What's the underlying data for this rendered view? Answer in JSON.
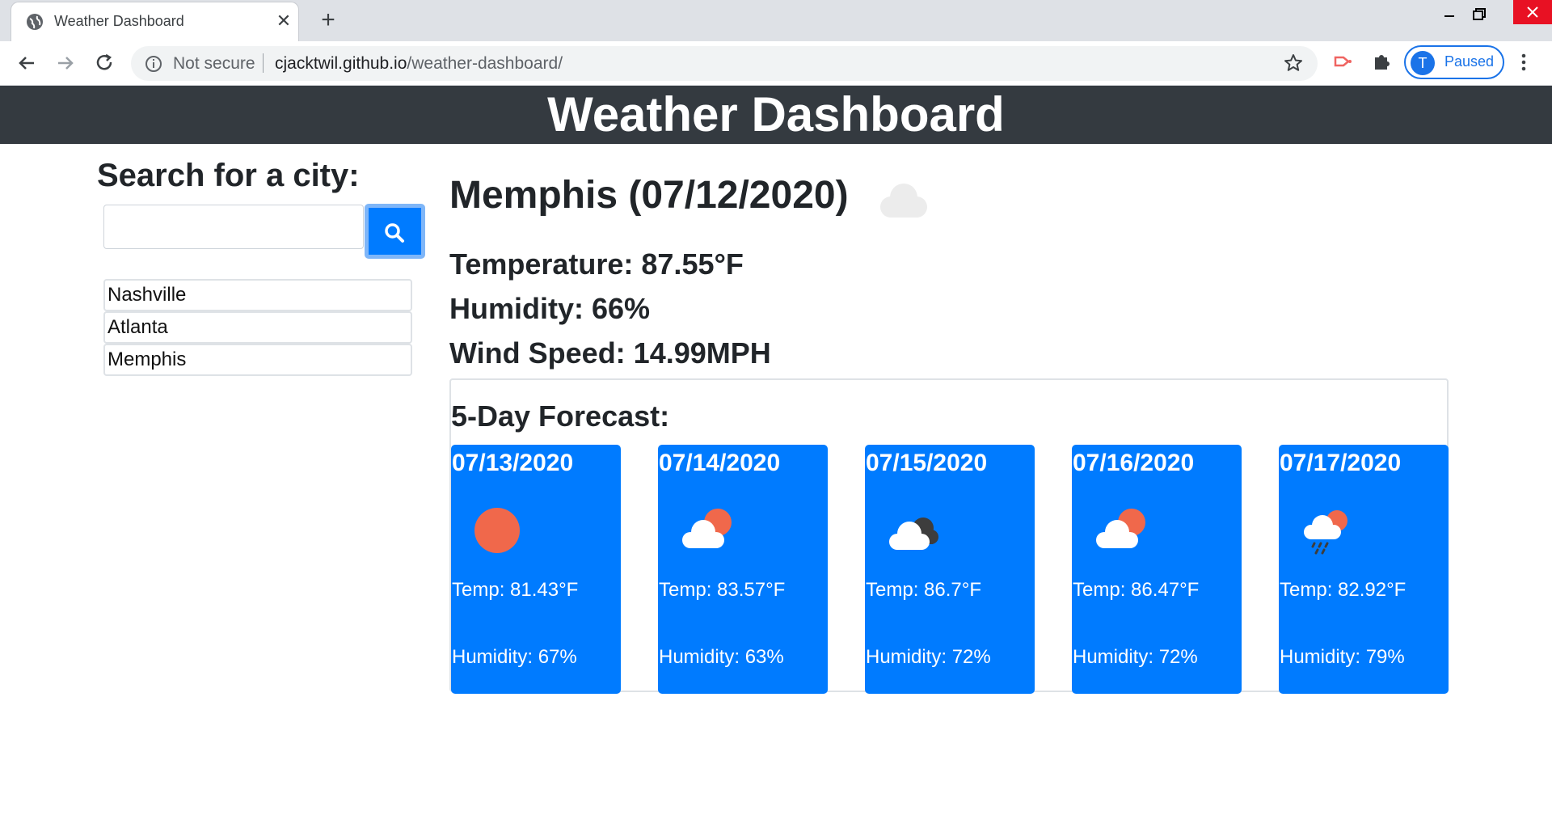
{
  "browser": {
    "tab_title": "Weather Dashboard",
    "security_label": "Not secure",
    "url_host": "cjacktwil.github.io",
    "url_path": "/weather-dashboard/",
    "profile_initial": "T",
    "profile_status": "Paused"
  },
  "header": {
    "title": "Weather Dashboard"
  },
  "search": {
    "heading": "Search for a city:",
    "input_value": "",
    "history": [
      "Nashville",
      "Atlanta",
      "Memphis"
    ]
  },
  "current": {
    "city_date": "Memphis (07/12/2020)",
    "icon": "cloud-icon",
    "temperature": "Temperature: 87.55°F",
    "humidity": "Humidity: 66%",
    "wind": "Wind Speed: 14.99MPH"
  },
  "forecast": {
    "heading": "5-Day Forecast:",
    "days": [
      {
        "date": "07/13/2020",
        "icon": "sun-icon",
        "temp": "Temp: 81.43°F",
        "humidity": "Humidity: 67%"
      },
      {
        "date": "07/14/2020",
        "icon": "partly-cloudy-icon",
        "temp": "Temp: 83.57°F",
        "humidity": "Humidity: 63%"
      },
      {
        "date": "07/15/2020",
        "icon": "broken-clouds-icon",
        "temp": "Temp: 86.7°F",
        "humidity": "Humidity: 72%"
      },
      {
        "date": "07/16/2020",
        "icon": "partly-cloudy-icon",
        "temp": "Temp: 86.47°F",
        "humidity": "Humidity: 72%"
      },
      {
        "date": "07/17/2020",
        "icon": "rain-icon",
        "temp": "Temp: 82.92°F",
        "humidity": "Humidity: 79%"
      }
    ]
  },
  "colors": {
    "header_bg": "#343a40",
    "card_bg": "#007bff",
    "sun": "#f0684b"
  }
}
